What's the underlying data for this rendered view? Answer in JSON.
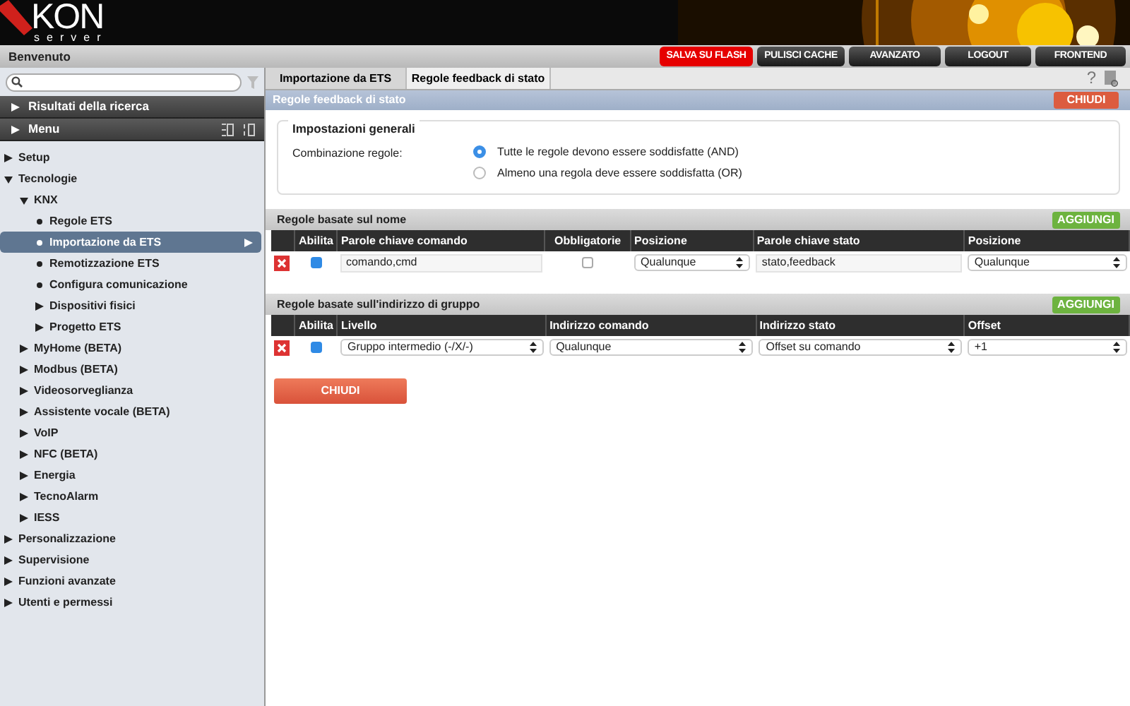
{
  "header": {
    "logo_text": "KON",
    "logo_subtext": "server"
  },
  "topbar": {
    "welcome": "Benvenuto",
    "buttons": [
      {
        "label": "SALVA SU FLASH",
        "kind": "danger"
      },
      {
        "label": "PULISCI CACHE",
        "kind": "dark"
      },
      {
        "label": "AVANZATO",
        "kind": "dark"
      },
      {
        "label": "LOGOUT",
        "kind": "dark"
      },
      {
        "label": "FRONTEND",
        "kind": "dark"
      }
    ]
  },
  "sidebar": {
    "sections": [
      {
        "label": "Risultati della ricerca",
        "expanded": false
      },
      {
        "label": "Menu",
        "expanded": false
      }
    ],
    "items": [
      {
        "label": "Setup",
        "kind": "folder",
        "expanded": false,
        "selected": false
      },
      {
        "label": "Tecnologie",
        "kind": "folder",
        "expanded": true,
        "selected": false,
        "children": [
          {
            "label": "KNX",
            "kind": "folder",
            "expanded": true,
            "selected": false,
            "children": [
              {
                "label": "Regole ETS",
                "kind": "leaf",
                "selected": false
              },
              {
                "label": "Importazione da ETS",
                "kind": "leaf",
                "selected": true
              },
              {
                "label": "Remotizzazione ETS",
                "kind": "leaf",
                "selected": false
              },
              {
                "label": "Configura comunicazione",
                "kind": "leaf",
                "selected": false
              },
              {
                "label": "Dispositivi fisici",
                "kind": "folder",
                "expanded": false,
                "selected": false
              },
              {
                "label": "Progetto ETS",
                "kind": "folder",
                "expanded": false,
                "selected": false
              }
            ]
          },
          {
            "label": "MyHome (BETA)",
            "kind": "folder",
            "expanded": false,
            "selected": false
          },
          {
            "label": "Modbus (BETA)",
            "kind": "folder",
            "expanded": false,
            "selected": false
          },
          {
            "label": "Videosorveglianza",
            "kind": "folder",
            "expanded": false,
            "selected": false
          },
          {
            "label": "Assistente vocale (BETA)",
            "kind": "folder",
            "expanded": false,
            "selected": false
          },
          {
            "label": "VoIP",
            "kind": "folder",
            "expanded": false,
            "selected": false
          },
          {
            "label": "NFC (BETA)",
            "kind": "folder",
            "expanded": false,
            "selected": false
          },
          {
            "label": "Energia",
            "kind": "folder",
            "expanded": false,
            "selected": false
          },
          {
            "label": "TecnoAlarm",
            "kind": "folder",
            "expanded": false,
            "selected": false
          },
          {
            "label": "IESS",
            "kind": "folder",
            "expanded": false,
            "selected": false
          }
        ]
      },
      {
        "label": "Personalizzazione",
        "kind": "folder",
        "expanded": false,
        "selected": false
      },
      {
        "label": "Supervisione",
        "kind": "folder",
        "expanded": false,
        "selected": false
      },
      {
        "label": "Funzioni avanzate",
        "kind": "folder",
        "expanded": false,
        "selected": false
      },
      {
        "label": "Utenti e permessi",
        "kind": "folder",
        "expanded": false,
        "selected": false
      }
    ]
  },
  "tabs": [
    {
      "label": "Importazione da ETS",
      "selected": false
    },
    {
      "label": "Regole feedback di stato",
      "selected": true
    }
  ],
  "help": "?",
  "panel": {
    "title": "Regole feedback di stato",
    "close": "CHIUDI",
    "general": {
      "legend": "Impostazioni generali",
      "label": "Combinazione regole:",
      "options": [
        {
          "label": "Tutte le regole devono essere soddisfatte (AND)",
          "selected": true
        },
        {
          "label": "Almeno una regola deve essere soddisfatta (OR)",
          "selected": false
        }
      ]
    },
    "sections": [
      {
        "title": "Regole basate sul nome",
        "add": "AGGIUNGI",
        "columns": [
          "",
          "Abilita",
          "Parole chiave comando",
          "Obbligatorie",
          "Posizione",
          "Parole chiave stato",
          "Posizione"
        ],
        "rows": [
          {
            "cells": [
              {
                "kind": "delete"
              },
              {
                "kind": "checkbox",
                "checked": true
              },
              {
                "kind": "text",
                "value": "comando,cmd"
              },
              {
                "kind": "checkbox",
                "checked": false
              },
              {
                "kind": "select",
                "value": "Qualunque"
              },
              {
                "kind": "text",
                "value": "stato,feedback"
              },
              {
                "kind": "select",
                "value": "Qualunque"
              }
            ]
          }
        ]
      },
      {
        "title": "Regole basate sull'indirizzo di gruppo",
        "add": "AGGIUNGI",
        "columns": [
          "",
          "Abilita",
          "Livello",
          "Indirizzo comando",
          "Indirizzo stato",
          "Offset"
        ],
        "rows": [
          {
            "cells": [
              {
                "kind": "delete"
              },
              {
                "kind": "checkbox",
                "checked": true
              },
              {
                "kind": "select",
                "value": "Gruppo intermedio (-/X/-)"
              },
              {
                "kind": "select",
                "value": "Qualunque"
              },
              {
                "kind": "select",
                "value": "Offset su comando"
              },
              {
                "kind": "select",
                "value": "+1"
              }
            ]
          }
        ]
      }
    ],
    "footer_button": "CHIUDI"
  }
}
